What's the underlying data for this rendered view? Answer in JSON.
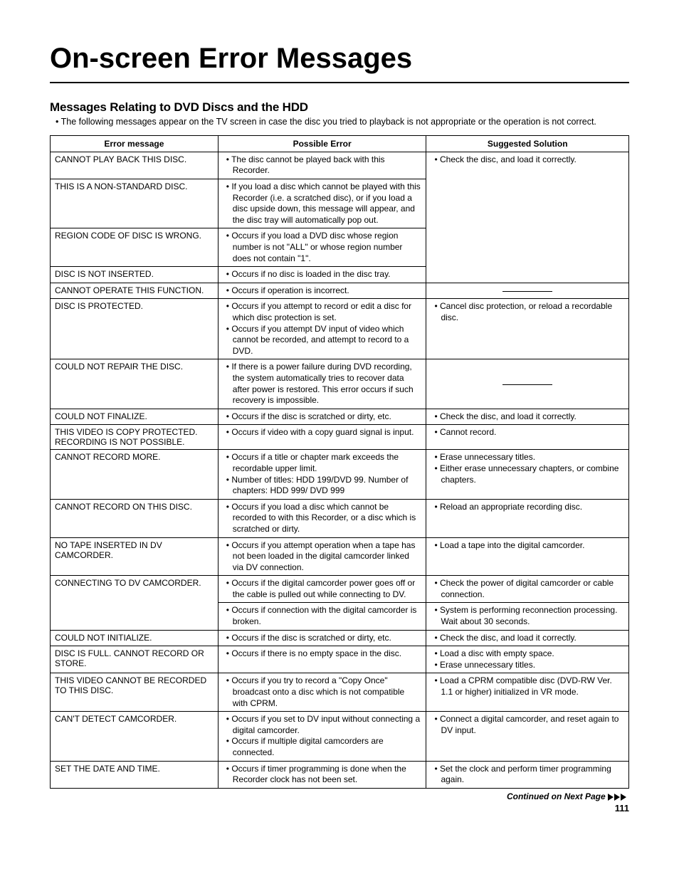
{
  "page_title": "On-screen Error Messages",
  "section_title": "Messages Relating to DVD Discs and the HDD",
  "intro": "• The following messages appear on the TV screen in case the disc you tried to playback is not appropriate or the operation is not correct.",
  "headers": {
    "c1": "Error message",
    "c2": "Possible Error",
    "c3": "Suggested Solution"
  },
  "rows": [
    {
      "msg": "CANNOT PLAY BACK THIS DISC.",
      "err": [
        "The disc cannot be played back with this Recorder."
      ],
      "sol": [
        "Check the disc, and load it correctly."
      ],
      "sol_span": 4
    },
    {
      "msg": "THIS IS A NON-STANDARD DISC.",
      "err": [
        "If you load a disc which cannot be played with this Recorder (i.e. a scratched disc), or if you load a disc upside down, this message will appear, and the disc tray will automatically pop out."
      ]
    },
    {
      "msg": "REGION CODE OF DISC IS WRONG.",
      "err": [
        "Occurs if you load a DVD disc whose region number is not \"ALL\" or whose region number does not contain \"1\"."
      ]
    },
    {
      "msg": "DISC IS NOT INSERTED.",
      "err": [
        "Occurs if no disc is loaded in the disc tray."
      ]
    },
    {
      "msg": "CANNOT OPERATE THIS FUNCTION.",
      "err": [
        "Occurs if operation is incorrect."
      ],
      "sol": "dash"
    },
    {
      "msg": "DISC IS PROTECTED.",
      "err": [
        "Occurs if you attempt to record or edit a disc for which disc protection is set.",
        "Occurs if you attempt DV input of video which cannot be recorded, and attempt to record to a DVD."
      ],
      "sol": [
        "Cancel disc protection, or reload a recordable disc."
      ],
      "sol_span": 2
    },
    {
      "msg": "COULD NOT REPAIR THE DISC.",
      "err": [
        "If there is a power failure during DVD recording, the system automatically tries to recover data after power is restored. This error occurs if such recovery is impossible."
      ],
      "sol": "dash_mid"
    },
    {
      "msg": "COULD NOT FINALIZE.",
      "err": [
        "Occurs if the disc is scratched or dirty, etc."
      ],
      "sol": [
        "Check the disc, and load it correctly."
      ]
    },
    {
      "msg": "THIS VIDEO IS COPY PROTECTED. RECORDING IS NOT POSSIBLE.",
      "err": [
        "Occurs if video with a copy guard signal is input."
      ],
      "sol": [
        "Cannot record."
      ]
    },
    {
      "msg": "CANNOT RECORD MORE.",
      "err": [
        "Occurs if a title or chapter mark exceeds the recordable upper limit.",
        "Number of titles: HDD 199/DVD 99. Number of chapters:  HDD 999/                                  DVD 999"
      ],
      "sol": [
        "Erase unnecessary titles.",
        "Either erase unnecessary chapters, or combine chapters."
      ]
    },
    {
      "msg": "CANNOT RECORD ON THIS DISC.",
      "err": [
        "Occurs if you load a disc which cannot be recorded to with this Recorder, or a disc which is scratched or dirty."
      ],
      "sol": [
        "Reload an appropriate recording disc."
      ]
    },
    {
      "msg": "NO TAPE INSERTED IN DV CAMCORDER.",
      "err": [
        "Occurs if you attempt operation when a tape has not been loaded in the digital camcorder linked via DV connection."
      ],
      "sol": [
        "Load a tape into the digital camcorder."
      ]
    },
    {
      "msg": "CONNECTING TO DV CAMCORDER.",
      "msg_span": 2,
      "err": [
        "Occurs if the digital camcorder power goes off or the cable is pulled out while connecting to DV."
      ],
      "sol": [
        "Check the power of digital camcorder or cable connection."
      ]
    },
    {
      "err": [
        "Occurs if connection with the digital camcorder is broken."
      ],
      "sol": [
        "System is performing reconnection processing. Wait about 30 seconds."
      ]
    },
    {
      "msg": "COULD NOT INITIALIZE.",
      "err": [
        "Occurs if the disc is scratched or dirty, etc."
      ],
      "sol": [
        "Check the disc, and load it correctly."
      ]
    },
    {
      "msg": "DISC IS FULL. CANNOT RECORD OR STORE.",
      "err": [
        "Occurs if there is no empty space in the disc."
      ],
      "sol": [
        "Load a disc with empty space.",
        "Erase unnecessary titles."
      ]
    },
    {
      "msg": "THIS VIDEO CANNOT BE RECORDED TO THIS DISC.",
      "err": [
        "Occurs if you try to record a \"Copy Once\" broadcast onto a disc which is not compatible with CPRM."
      ],
      "sol": [
        "Load a CPRM compatible disc (DVD-RW Ver. 1.1 or higher) initialized in VR mode."
      ]
    },
    {
      "msg": "CAN'T DETECT CAMCORDER.",
      "err": [
        "Occurs if you set to DV input without connecting a digital camcorder.",
        "Occurs if multiple digital camcorders are connected."
      ],
      "sol": [
        "Connect a digital camcorder, and reset again to DV input."
      ]
    },
    {
      "msg": "SET THE DATE AND TIME.",
      "err": [
        "Occurs if timer programming is done when the Recorder clock has not been set."
      ],
      "sol": [
        "Set the clock and perform timer programming again."
      ]
    }
  ],
  "continued": "Continued on Next Page",
  "page_num": "111"
}
